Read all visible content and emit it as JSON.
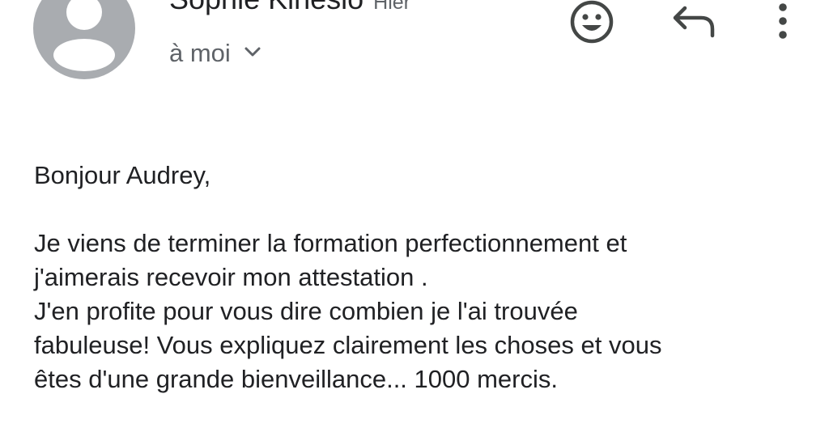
{
  "header": {
    "sender_name": "Sophie Kinésio",
    "date": "Hier",
    "recipient": "à moi",
    "icons": {
      "avatar": "person-avatar-icon",
      "emoji": "smiley-face-icon",
      "reply": "reply-arrow-icon",
      "more": "more-vertical-icon",
      "expand": "chevron-down-icon"
    }
  },
  "message": {
    "greeting": "Bonjour Audrey,",
    "lines": [
      "Je viens de terminer la formation perfectionnement et",
      "j'aimerais recevoir mon attestation .",
      "J'en profite pour vous dire combien je l'ai trouvée",
      "fabuleuse! Vous expliquez clairement les choses et vous",
      "êtes d'une grande bienveillance... 1000 mercis."
    ]
  },
  "colors": {
    "avatar_bg": "#a9acb0",
    "text_primary": "#202124",
    "text_secondary": "#5f6368"
  }
}
